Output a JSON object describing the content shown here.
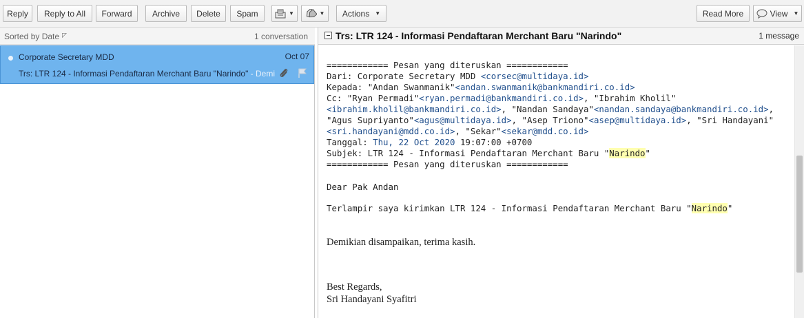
{
  "toolbar": {
    "reply": "Reply",
    "reply_all": "Reply to All",
    "forward": "Forward",
    "archive": "Archive",
    "delete": "Delete",
    "spam": "Spam",
    "actions": "Actions",
    "read_more": "Read More",
    "view": "View"
  },
  "message_list": {
    "sort_label": "Sorted by Date",
    "conversation_count": "1 conversation",
    "items": [
      {
        "sender": "Corporate Secretary MDD",
        "date": "Oct 07",
        "subject": "Trs: LTR 124 - Informasi Pendaftaran Merchant Baru \"Narindo\"",
        "snippet": " - Demikian disampaikan, terima kasih."
      }
    ]
  },
  "reader": {
    "subject": "Trs: LTR 124 - Informasi Pendaftaran Merchant Baru \"Narindo\"",
    "message_count": "1 message",
    "forward_separator": "============ Pesan yang diteruskan ============",
    "from_label": "Dari: ",
    "from_name": "Corporate Secretary MDD ",
    "from_email": "<corsec@multidaya.id>",
    "to_label": "Kepada: ",
    "to_name": "\"Andan Swanmanik\"",
    "to_email": "<andan.swanmanik@bankmandiri.co.id>",
    "cc_label": "Cc: ",
    "cc1_name": "\"Ryan Permadi\"",
    "cc1_email": "<ryan.permadi@bankmandiri.co.id>",
    "cc2_name": ", \"Ibrahim Kholil\"",
    "cc2_email": "<ibrahim.kholil@bankmandiri.co.id>",
    "cc3_name": ", \"Nandan Sandaya\"",
    "cc3_email": "<nandan.sandaya@bankmandiri.co.id>",
    "cc3_tail": ",",
    "cc4_name": "\"Agus Supriyanto\"",
    "cc4_email": "<agus@multidaya.id>",
    "cc5_name": ", \"Asep Triono\"",
    "cc5_email": "<asep@multidaya.id>",
    "cc6_name": ", \"Sri Handayani\"",
    "cc6_email": "<sri.handayani@mdd.co.id>",
    "cc7_name": ", \"Sekar\"",
    "cc7_email": "<sekar@mdd.co.id>",
    "date_label": "Tanggal: ",
    "date_value": "Thu, 22 Oct 2020",
    "date_time": " 19:07:00 +0700",
    "subject_label": "Subjek: LTR 124 - Informasi Pendaftaran Merchant Baru \"",
    "subject_highlight": "Narindo",
    "subject_end": "\"",
    "greeting": "Dear Pak Andan",
    "body_line": "Terlampir saya kirimkan LTR 124 - Informasi Pendaftaran Merchant Baru \"",
    "body_highlight": "Narindo",
    "body_end": "\"",
    "closing": "Demikian disampaikan, terima kasih.",
    "regards": "Best Regards,",
    "signature": "Sri Handayani Syafitri"
  },
  "colors": {
    "selected_row": "#6fb4ee",
    "link": "#1f4e8c",
    "highlight": "#ffffb0"
  }
}
